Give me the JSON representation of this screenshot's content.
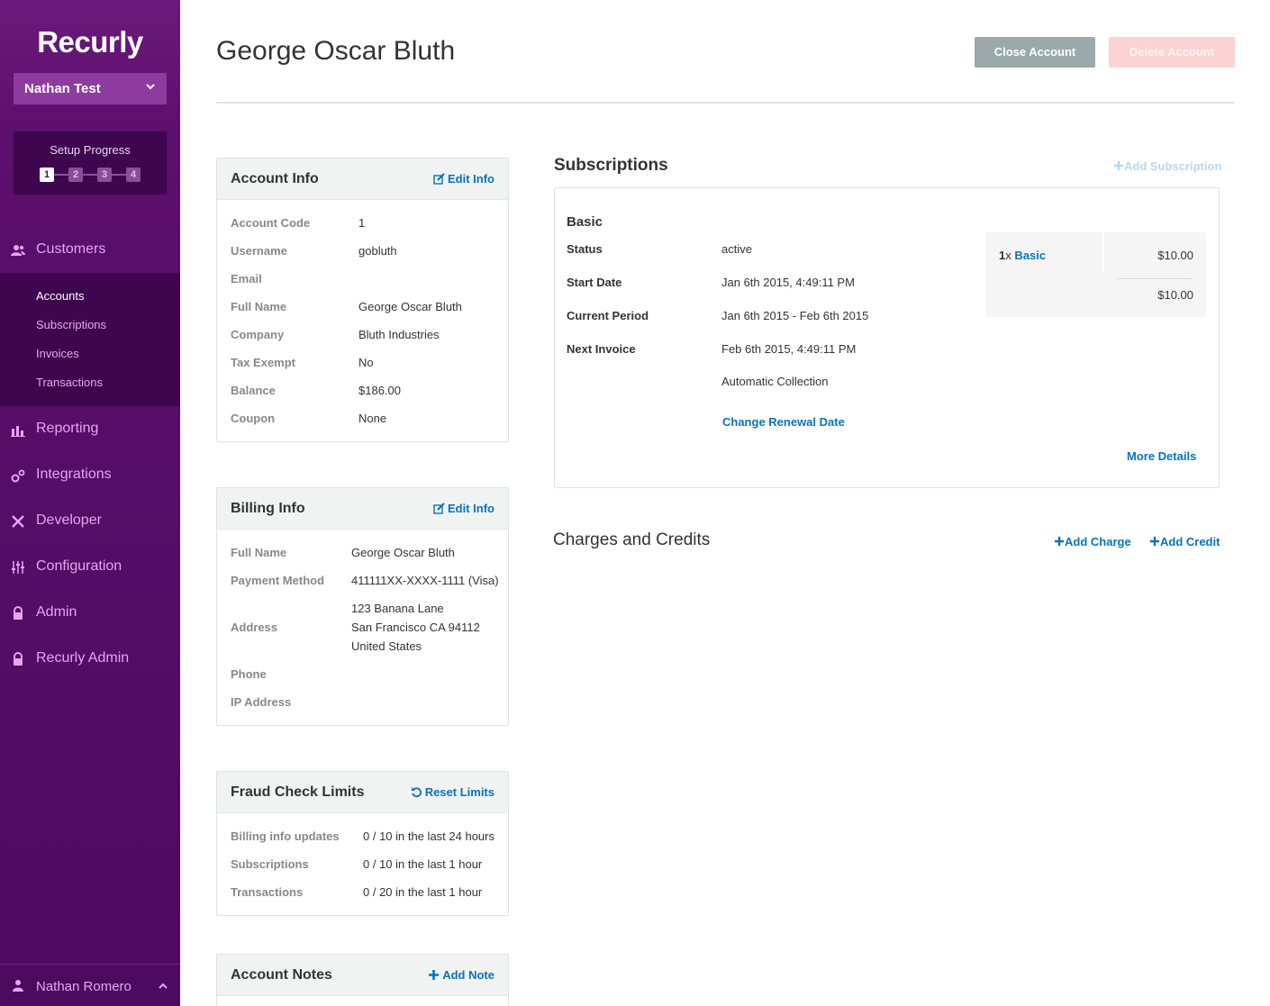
{
  "brand": {
    "logo": "Recurly",
    "accent": "#0a73b8",
    "sidebar_bg": "#4e0a5e"
  },
  "sidebar": {
    "site_selector": "Nathan Test",
    "setup_progress": {
      "title": "Setup Progress",
      "steps": [
        "1",
        "2",
        "3",
        "4"
      ],
      "active_step": 1
    },
    "nav": [
      {
        "label": "Customers",
        "icon": "users-icon"
      },
      {
        "label": "Reporting",
        "icon": "bar-chart-icon"
      },
      {
        "label": "Integrations",
        "icon": "gears-icon"
      },
      {
        "label": "Developer",
        "icon": "tools-icon"
      },
      {
        "label": "Configuration",
        "icon": "sliders-icon"
      },
      {
        "label": "Admin",
        "icon": "lock-icon"
      },
      {
        "label": "Recurly Admin",
        "icon": "lock-icon"
      }
    ],
    "customers_sub": [
      "Accounts",
      "Subscriptions",
      "Invoices",
      "Transactions"
    ],
    "active_sub": "Accounts",
    "user": "Nathan Romero"
  },
  "header": {
    "title": "George Oscar Bluth",
    "close_button": "Close Account",
    "delete_button": "Delete Account"
  },
  "account_info": {
    "title": "Account Info",
    "action": "Edit Info",
    "rows": [
      {
        "label": "Account Code",
        "value": "1"
      },
      {
        "label": "Username",
        "value": "gobluth"
      },
      {
        "label": "Email",
        "value": ""
      },
      {
        "label": "Full Name",
        "value": "George Oscar Bluth"
      },
      {
        "label": "Company",
        "value": "Bluth Industries"
      },
      {
        "label": "Tax Exempt",
        "value": "No"
      },
      {
        "label": "Balance",
        "value": "$186.00"
      },
      {
        "label": "Coupon",
        "value": "None"
      }
    ]
  },
  "billing_info": {
    "title": "Billing Info",
    "action": "Edit Info",
    "full_name_label": "Full Name",
    "full_name": "George Oscar Bluth",
    "payment_label": "Payment Method",
    "payment": "411111XX-XXXX-1111 (Visa)",
    "address_label": "Address",
    "address_lines": [
      "123 Banana Lane",
      "San Francisco CA 94112",
      "United States"
    ],
    "phone_label": "Phone",
    "ip_label": "IP Address"
  },
  "fraud_limits": {
    "title": "Fraud Check Limits",
    "action": "Reset Limits",
    "rows": [
      {
        "label": "Billing info updates",
        "value": "0 / 10 in the last 24 hours"
      },
      {
        "label": "Subscriptions",
        "value": "0 / 10 in the last 1 hour"
      },
      {
        "label": "Transactions",
        "value": "0 / 20 in the last 1 hour"
      }
    ]
  },
  "account_notes": {
    "title": "Account Notes",
    "action": "Add Note"
  },
  "subscriptions": {
    "title": "Subscriptions",
    "add_label": "Add Subscription",
    "plan": "Basic",
    "rows": [
      {
        "label": "Status",
        "value": "active"
      },
      {
        "label": "Start Date",
        "value": "Jan 6th 2015, 4:49:11 PM"
      },
      {
        "label": "Current Period",
        "value": "Jan 6th 2015 - Feb 6th 2015"
      },
      {
        "label": "Next Invoice",
        "value": "Feb 6th 2015, 4:49:11 PM"
      }
    ],
    "collection": "Automatic Collection",
    "change_renewal": "Change Renewal Date",
    "more_details": "More Details",
    "line_item": {
      "qty": "1",
      "qty_suffix": "x",
      "name": "Basic",
      "amount": "$10.00",
      "total": "$10.00"
    }
  },
  "charges": {
    "title": "Charges and Credits",
    "add_charge": "Add Charge",
    "add_credit": "Add Credit"
  }
}
